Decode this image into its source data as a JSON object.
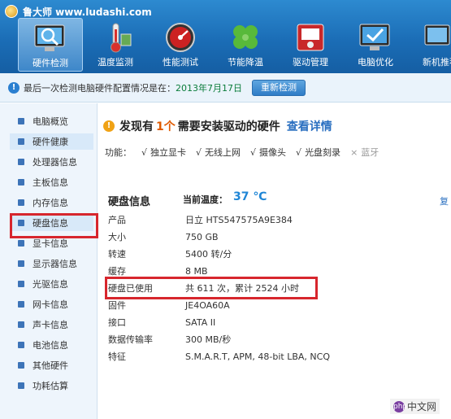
{
  "app": {
    "title": "鲁大师 www.ludashi.com"
  },
  "nav": [
    {
      "label": "硬件检测",
      "icon": "monitor-magnifier-icon",
      "active": true
    },
    {
      "label": "温度监测",
      "icon": "thermometer-icon",
      "active": false
    },
    {
      "label": "性能测试",
      "icon": "speedometer-icon",
      "active": false
    },
    {
      "label": "节能降温",
      "icon": "clover-icon",
      "active": false
    },
    {
      "label": "驱动管理",
      "icon": "toolbox-icon",
      "active": false
    },
    {
      "label": "电脑优化",
      "icon": "monitor-check-icon",
      "active": false
    },
    {
      "label": "新机推荐",
      "icon": "computer-icon",
      "active": false
    }
  ],
  "status": {
    "text": "最后一次检测电脑硬件配置情况是在：",
    "date": "2013年7月17日",
    "recheck_label": "重新检测"
  },
  "sidebar": [
    {
      "label": "电脑概览",
      "active": false
    },
    {
      "label": "硬件健康",
      "active": true
    },
    {
      "label": "处理器信息",
      "active": false
    },
    {
      "label": "主板信息",
      "active": false
    },
    {
      "label": "内存信息",
      "active": false
    },
    {
      "label": "硬盘信息",
      "active": false
    },
    {
      "label": "显卡信息",
      "active": false
    },
    {
      "label": "显示器信息",
      "active": false
    },
    {
      "label": "光驱信息",
      "active": false
    },
    {
      "label": "网卡信息",
      "active": false
    },
    {
      "label": "声卡信息",
      "active": false
    },
    {
      "label": "电池信息",
      "active": false
    },
    {
      "label": "其他硬件",
      "active": false
    },
    {
      "label": "功耗估算",
      "active": false
    }
  ],
  "alert": {
    "prefix": "发现有",
    "count": "1个",
    "suffix": "需要安装驱动的硬件",
    "link": "查看详情"
  },
  "features": {
    "label": "功能：",
    "items": [
      {
        "label": "独立显卡",
        "mark": "√",
        "enabled": true
      },
      {
        "label": "无线上网",
        "mark": "√",
        "enabled": true
      },
      {
        "label": "摄像头",
        "mark": "√",
        "enabled": true
      },
      {
        "label": "光盘刻录",
        "mark": "√",
        "enabled": true
      },
      {
        "label": "蓝牙",
        "mark": "×",
        "enabled": false
      }
    ]
  },
  "disk": {
    "section_title": "硬盘信息",
    "temp_label": "当前温度：",
    "temp_value": "37 ℃",
    "right_link": "复",
    "rows": [
      {
        "key": "产品",
        "value": "日立  HTS547575A9E384"
      },
      {
        "key": "大小",
        "value": "750 GB"
      },
      {
        "key": "转速",
        "value": "5400 转/分"
      },
      {
        "key": "缓存",
        "value": "8 MB"
      },
      {
        "key": "硬盘已使用",
        "value": "共 611 次，累计 2524 小时"
      },
      {
        "key": "固件",
        "value": "JE4OA60A"
      },
      {
        "key": "接口",
        "value": "SATA II"
      },
      {
        "key": "数据传输率",
        "value": "300 MB/秒"
      },
      {
        "key": "特征",
        "value": "S.M.A.R.T,  APM,  48-bit LBA,  NCQ"
      }
    ]
  },
  "watermark": {
    "text": "中文网",
    "icon_text": "php"
  }
}
